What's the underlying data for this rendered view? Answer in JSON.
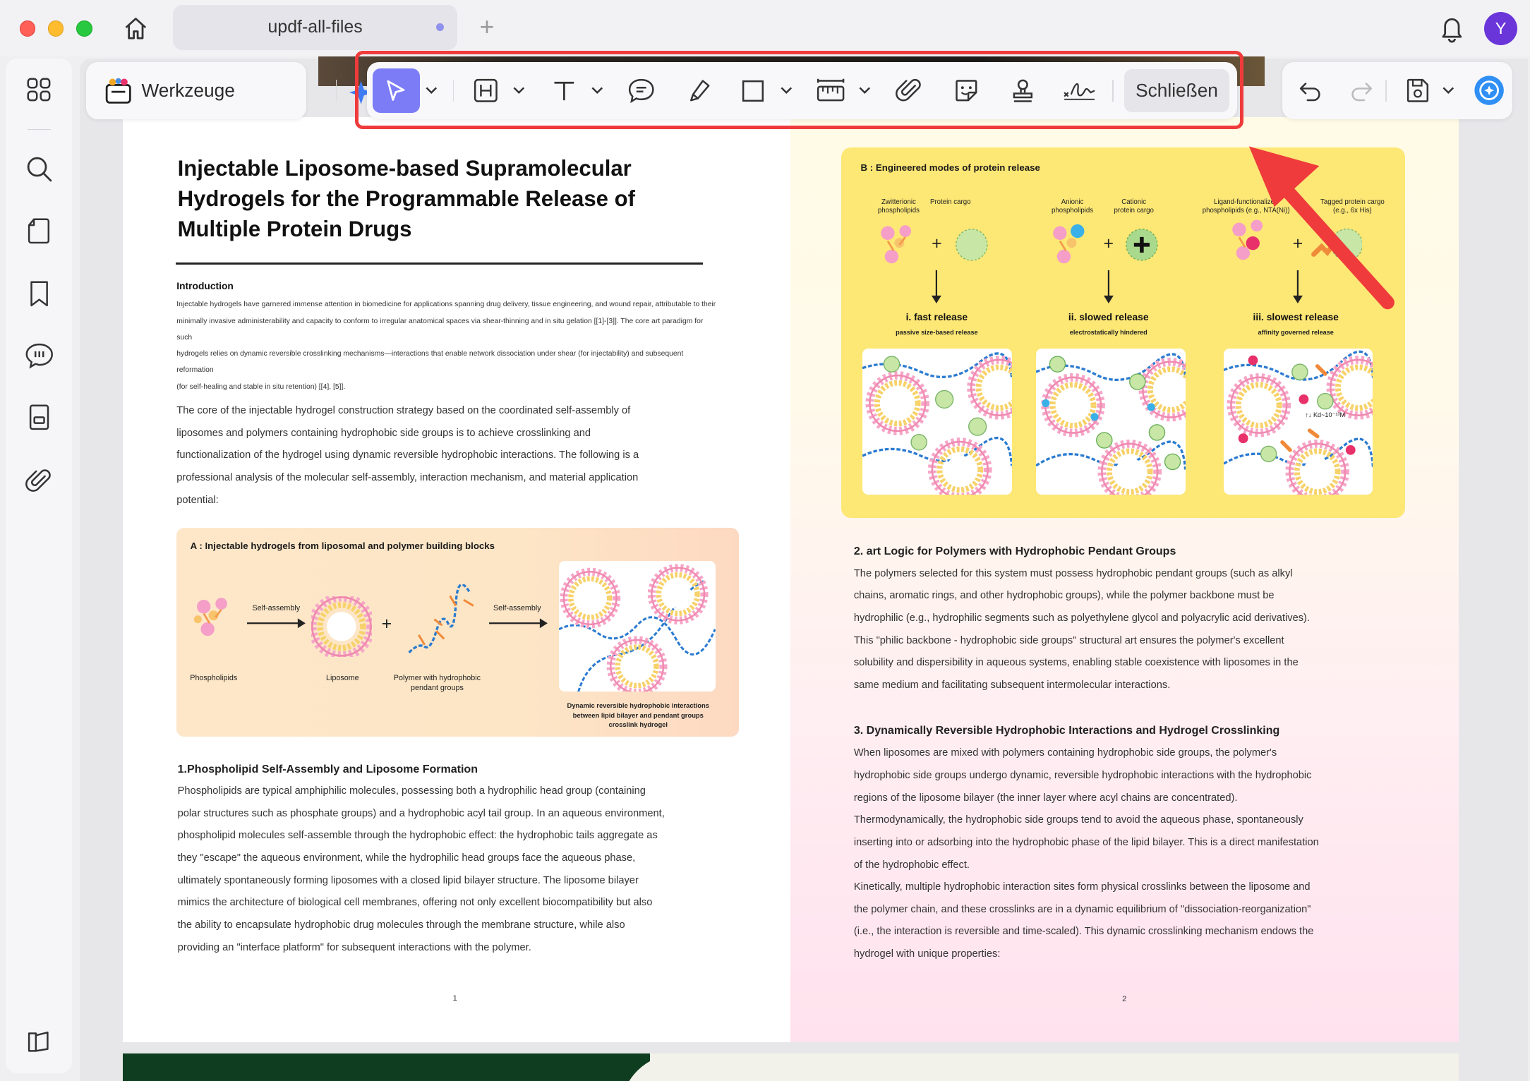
{
  "window": {
    "tab_title": "updf-all-files",
    "new_tab_symbol": "+",
    "avatar_letter": "Y"
  },
  "toolbar": {
    "tools_label": "Werkzeuge",
    "close_label": "Schließen"
  },
  "accent_colors": {
    "active_tool": "#7b7cf6",
    "highlight_box": "#ef3b3b",
    "avatar": "#6a35d9"
  },
  "sidebar": {
    "items": [
      {
        "icon": "apps-grid-icon"
      },
      {
        "icon": "search-icon"
      },
      {
        "icon": "pages-icon"
      },
      {
        "icon": "bookmark-icon"
      },
      {
        "icon": "comment-icon"
      },
      {
        "icon": "form-icon"
      },
      {
        "icon": "attachment-icon"
      }
    ],
    "bottom_icon": "reader-mode-icon"
  },
  "page1": {
    "title": "Injectable Liposome-based Supramolecular Hydrogels for the Programmable Release of Multiple Protein Drugs",
    "intro_heading": "Introduction",
    "intro_lines": [
      "Injectable hydrogels have garnered immense attention in biomedicine for applications spanning drug delivery, tissue engineering, and wound repair, attributable to their",
      "minimally invasive administerability and capacity to conform to irregular anatomical spaces via shear-thinning and in situ gelation [[1]-[3]]. The core art paradigm for such",
      "hydrogels relies on dynamic reversible crosslinking mechanisms—interactions that enable network dissociation under shear (for injectability) and subsequent reformation",
      "(for self-healing and stable in situ retention) [[4], [5]]."
    ],
    "para1_lines": [
      "The core of the injectable hydrogel construction strategy based on the coordinated self-assembly of",
      "liposomes and polymers containing hydrophobic side groups is to achieve crosslinking and",
      "functionalization of the hydrogel using dynamic reversible hydrophobic interactions. The following is a",
      "professional analysis of the molecular self-assembly, interaction mechanism, and material application",
      "potential:"
    ],
    "figure_a": {
      "title": "A : Injectable hydrogels from liposomal and polymer building blocks",
      "self_assembly_1": "Self-assembly",
      "self_assembly_2": "Self-assembly",
      "phospholipids": "Phospholipids",
      "liposome": "Liposome",
      "polymer_line1": "Polymer with hydrophobic",
      "polymer_line2": "pendant groups",
      "plus": "+",
      "caption_line1": "Dynamic reversible hydrophobic interactions",
      "caption_line2": "between lipid bilayer and pendant groups",
      "caption_line3": "crosslink hydrogel"
    },
    "section1_heading": "1.Phospholipid Self-Assembly and Liposome Formation",
    "section1_lines": [
      "Phospholipids are typical amphiphilic molecules, possessing both a hydrophilic head group (containing",
      "polar structures such as phosphate groups) and a hydrophobic acyl tail group. In an aqueous environment,",
      "phospholipid molecules self-assemble through the hydrophobic effect: the hydrophobic tails aggregate as",
      "they \"escape\" the aqueous environment, while the hydrophilic head groups face the aqueous phase,",
      "ultimately spontaneously forming liposomes with a closed lipid bilayer structure. The liposome bilayer",
      "mimics the architecture of biological cell membranes, offering not only excellent biocompatibility but also",
      "the ability to encapsulate hydrophobic drug molecules through the membrane structure, while also",
      "providing an \"interface platform\" for subsequent interactions with the polymer."
    ],
    "page_number": "1"
  },
  "page2": {
    "figure_b": {
      "title": "B : Engineered modes of protein release",
      "col1_a": "Zwitterionic",
      "col1_a2": "phospholipids",
      "col1_b": "Protein cargo",
      "col2_a": "Anionic",
      "col2_a2": "phospholipids",
      "col2_b": "Cationic",
      "col2_b2": "protein cargo",
      "col3_a": "Ligand-functionalized",
      "col3_a2": "phospholipids (e.g., NTA(Ni))",
      "col3_b": "Tagged protein cargo",
      "col3_b2": "(e.g., 6x His)",
      "plus": "+",
      "release1": "i. fast release",
      "release1_sub": "passive size-based release",
      "release2": "ii. slowed release",
      "release2_sub": "electrostatically hindered",
      "release3": "iii. slowest release",
      "release3_sub": "affinity governed release",
      "kd_label": "↑↓ Kd~10⁻¹³M"
    },
    "section2_heading": "2. art Logic for Polymers with Hydrophobic Pendant Groups",
    "section2_lines": [
      "The polymers selected for this system must possess hydrophobic pendant groups (such as alkyl",
      "chains, aromatic rings, and other hydrophobic groups), while the polymer backbone must be",
      "hydrophilic (e.g., hydrophilic segments such as polyethylene glycol and polyacrylic acid derivatives).",
      "This \"philic backbone - hydrophobic side groups\" structural art ensures the polymer's excellent",
      "solubility and dispersibility in aqueous systems, enabling stable coexistence with liposomes in the",
      "same medium and facilitating subsequent intermolecular interactions."
    ],
    "section3_heading": "3. Dynamically Reversible Hydrophobic Interactions and Hydrogel Crosslinking",
    "section3_lines": [
      "When liposomes are mixed with polymers containing hydrophobic side groups, the polymer's",
      "hydrophobic side groups undergo dynamic, reversible hydrophobic interactions with the hydrophobic",
      "regions of the liposome bilayer (the inner layer where acyl chains are concentrated).",
      "Thermodynamically, the hydrophobic side groups tend to avoid the aqueous phase, spontaneously",
      "inserting into or adsorbing into the hydrophobic phase of the lipid bilayer. This is a direct manifestation",
      "of the hydrophobic effect.",
      "Kinetically, multiple hydrophobic interaction sites form physical crosslinks between the liposome and",
      "the polymer chain, and these crosslinks are in a dynamic equilibrium of \"dissociation-reorganization\"",
      "(i.e., the interaction is reversible and time-scaled). This dynamic crosslinking mechanism endows the",
      "hydrogel with unique properties:"
    ],
    "page_number": "2"
  }
}
